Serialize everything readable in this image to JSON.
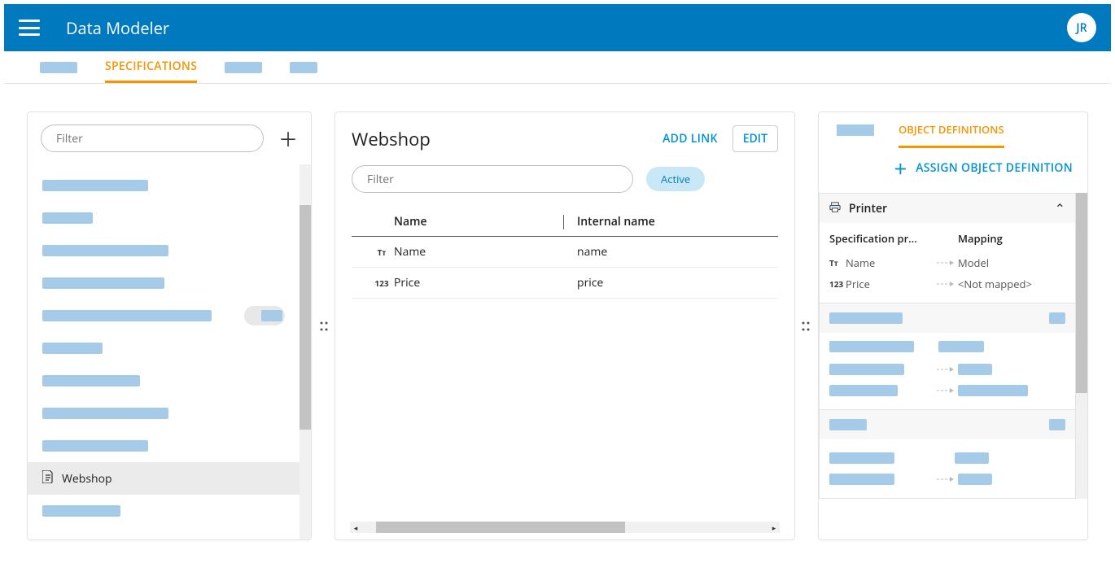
{
  "app": {
    "title": "Data Modeler",
    "avatar": "JR"
  },
  "tabs": {
    "active": "SPECIFICATIONS"
  },
  "left": {
    "filter_placeholder": "Filter",
    "selected_label": "Webshop"
  },
  "center": {
    "title": "Webshop",
    "add_link": "ADD LINK",
    "edit": "EDIT",
    "filter_placeholder": "Filter",
    "status": "Active",
    "columns": {
      "name": "Name",
      "internal": "Internal name"
    },
    "rows": [
      {
        "type": "Tᴛ",
        "name": "Name",
        "internal": "name"
      },
      {
        "type": "123",
        "name": "Price",
        "internal": "price"
      }
    ]
  },
  "right": {
    "active_tab": "OBJECT DEFINITIONS",
    "assign": "ASSIGN OBJECT DEFINITION",
    "defs": [
      {
        "title": "Printer",
        "spec_col": "Specification pr…",
        "map_col": "Mapping",
        "rows": [
          {
            "type": "Tᴛ",
            "name": "Name",
            "target": "Model"
          },
          {
            "type": "123",
            "name": "Price",
            "target": "<Not mapped>"
          }
        ]
      }
    ]
  }
}
